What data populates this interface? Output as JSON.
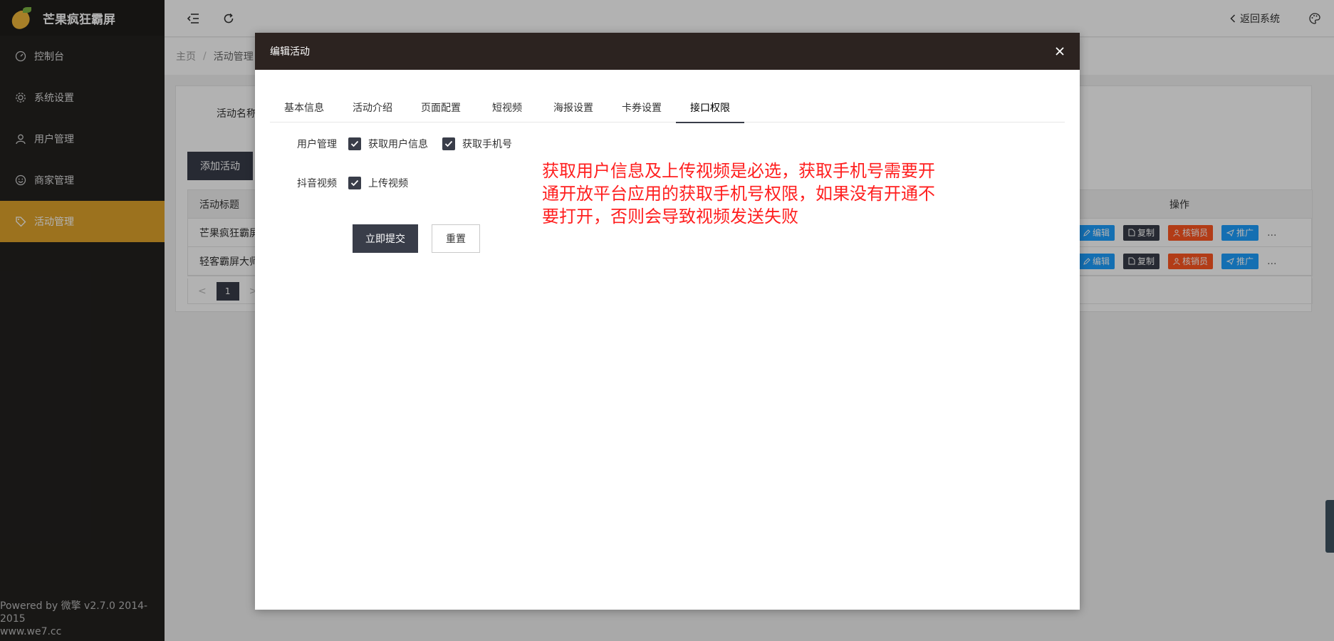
{
  "app": {
    "title": "芒果疯狂霸屏"
  },
  "sidebar": {
    "items": [
      {
        "label": "控制台",
        "icon": "dashboard-icon"
      },
      {
        "label": "系统设置",
        "icon": "gear-icon"
      },
      {
        "label": "用户管理",
        "icon": "user-icon"
      },
      {
        "label": "商家管理",
        "icon": "smile-icon"
      },
      {
        "label": "活动管理",
        "icon": "tag-icon",
        "active": true
      }
    ],
    "footer_line1": "Powered by 微擎 v2.7.0 2014-2015",
    "footer_line2": "www.we7.cc"
  },
  "topbar": {
    "back_label": "返回系统"
  },
  "breadcrumb": {
    "home": "主页",
    "sep": "/",
    "current": "活动管理"
  },
  "content": {
    "search_label": "活动名称",
    "add_button": "添加活动",
    "table": {
      "col_title": "活动标题",
      "col_ops": "操作",
      "rows": [
        {
          "title": "芒果疯狂霸屏"
        },
        {
          "title": "轻客霸屏大师"
        }
      ],
      "ops": {
        "edit": "编辑",
        "copy": "复制",
        "verifier": "核销员",
        "promote": "推广",
        "more": "..."
      }
    },
    "pager": {
      "prev": "<",
      "page": "1",
      "next": ">"
    }
  },
  "modal": {
    "title": "编辑活动",
    "tabs": [
      "基本信息",
      "活动介绍",
      "页面配置",
      "短视频",
      "海报设置",
      "卡券设置",
      "接口权限"
    ],
    "active_tab": 6,
    "form": {
      "row1_label": "用户管理",
      "row1_opt1": "获取用户信息",
      "row1_opt2": "获取手机号",
      "row2_label": "抖音视频",
      "row2_opt1": "上传视频",
      "submit": "立即提交",
      "reset": "重置"
    },
    "note": "获取用户信息及上传视频是必选，获取手机号需要开通开放平台应用的获取手机号权限，如果没有开通不要打开，否则会导致视频发送失败"
  },
  "colors": {
    "sidebar_bg": "#23211f",
    "active_nav": "#e0a42b",
    "dark_button": "#393d49",
    "modal_header": "#2c2320",
    "note_red": "#ff1f1f"
  }
}
